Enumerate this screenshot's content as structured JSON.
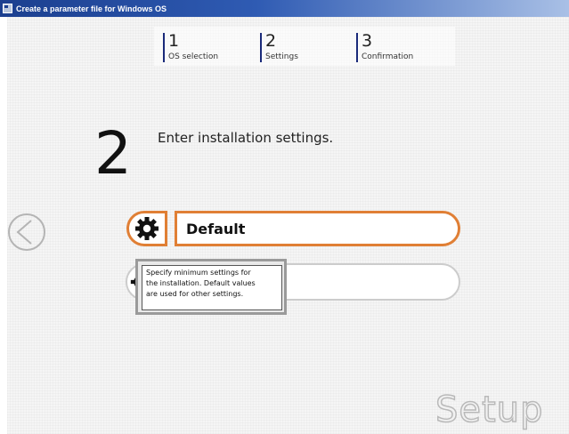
{
  "window": {
    "title": "Create a parameter file for Windows OS"
  },
  "steps": [
    {
      "number": "1",
      "label": "OS selection"
    },
    {
      "number": "2",
      "label": "Settings"
    },
    {
      "number": "3",
      "label": "Confirmation"
    }
  ],
  "main": {
    "step_number": "2",
    "heading": "Enter installation settings."
  },
  "options": {
    "default_label": "Default",
    "custom_label": ""
  },
  "tooltip": {
    "line1": "Specify minimum settings for",
    "line2": "the installation. Default values",
    "line3": "are used for other settings."
  },
  "brand": {
    "text": "Setup"
  },
  "icons": {
    "back": "back-arrow-icon",
    "gear": "gear-icon",
    "app": "app-icon"
  },
  "colors": {
    "accent": "#e07f35",
    "titlebar": "#1b3f8f"
  }
}
